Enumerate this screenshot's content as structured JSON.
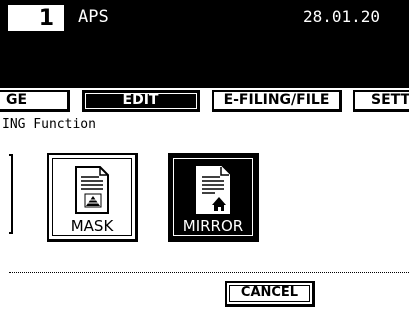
{
  "header": {
    "copy_count": "1",
    "mode": "APS",
    "date": "28.01.20"
  },
  "tabs": [
    {
      "label": "GE",
      "active": false
    },
    {
      "label": "EDIT",
      "active": true
    },
    {
      "label": "E-FILING/FILE",
      "active": false
    },
    {
      "label": "SETT",
      "active": false
    }
  ],
  "function_label": "ING Function",
  "functions": [
    {
      "label": "MASK",
      "selected": false,
      "icon": "mask-document-icon"
    },
    {
      "label": "MIRROR",
      "selected": true,
      "icon": "mirror-document-icon"
    }
  ],
  "cancel_label": "CANCEL",
  "colors": {
    "background": "#ffffff",
    "foreground": "#000000"
  }
}
